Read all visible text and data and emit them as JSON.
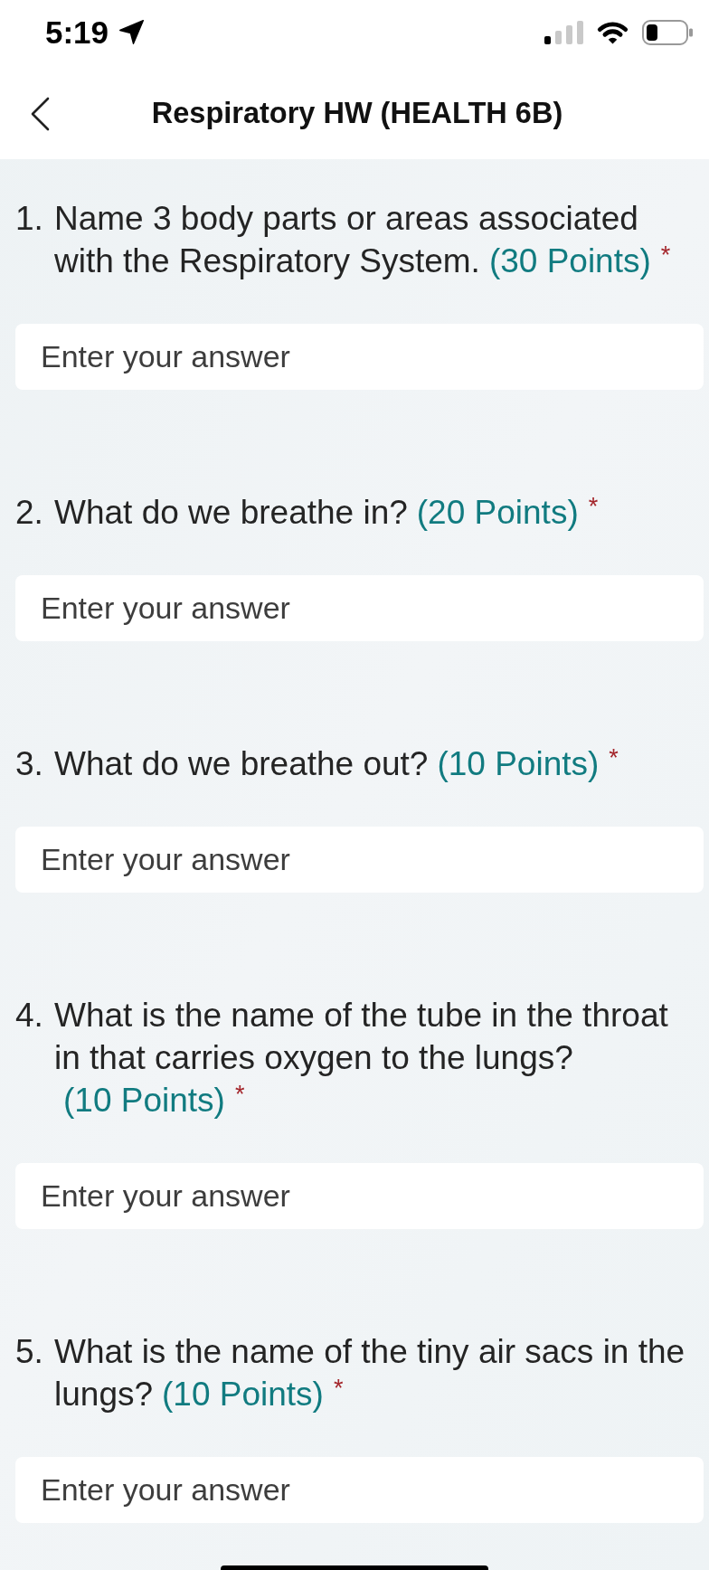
{
  "status_bar": {
    "time": "5:19"
  },
  "header": {
    "title": "Respiratory HW (HEALTH 6B)"
  },
  "questions": [
    {
      "number": "1.",
      "text": "Name 3 body parts or areas associated with the Respiratory System.",
      "points": "(30 Points)",
      "required_mark": "*",
      "answer": {
        "placeholder": "Enter your answer"
      }
    },
    {
      "number": "2.",
      "text": "What do we breathe in?",
      "points": "(20 Points)",
      "required_mark": "*",
      "answer": {
        "placeholder": "Enter your answer"
      }
    },
    {
      "number": "3.",
      "text": "What do we breathe out?",
      "points": "(10 Points)",
      "required_mark": "*",
      "answer": {
        "placeholder": "Enter your answer"
      }
    },
    {
      "number": "4.",
      "text": "What is the name of the tube in the throat in that carries oxygen to the lungs?",
      "points": "(10 Points)",
      "required_mark": "*",
      "answer": {
        "placeholder": "Enter your answer"
      }
    },
    {
      "number": "5.",
      "text": "What is the name of the tiny air sacs in the lungs?",
      "points": "(10 Points)",
      "required_mark": "*",
      "answer": {
        "placeholder": "Enter your answer"
      }
    }
  ]
}
